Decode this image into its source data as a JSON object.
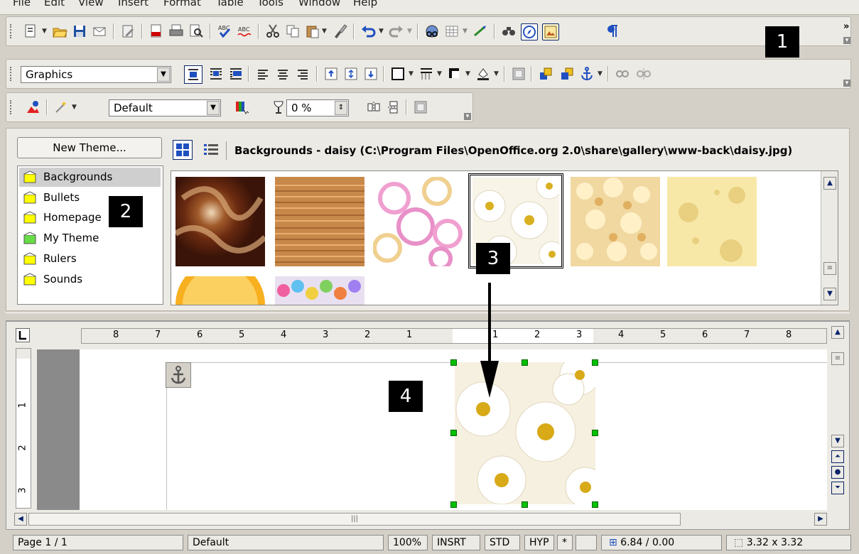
{
  "menu": [
    "File",
    "Edit",
    "View",
    "Insert",
    "Format",
    "Table",
    "Tools",
    "Window",
    "Help"
  ],
  "toolbar2": {
    "style_combo": "Graphics"
  },
  "toolbar3": {
    "mode_combo": "Default",
    "transparency": "0 %"
  },
  "callouts": [
    "1",
    "2",
    "3",
    "4"
  ],
  "gallery": {
    "new_theme_label": "New Theme...",
    "title": "Backgrounds - daisy (C:\\Program Files\\OpenOffice.org 2.0\\share\\gallery\\www-back\\daisy.jpg)",
    "themes": [
      {
        "label": "Backgrounds",
        "color": "#ffff00"
      },
      {
        "label": "Bullets",
        "color": "#ffff00"
      },
      {
        "label": "Homepage",
        "color": "#ffff00"
      },
      {
        "label": "My Theme",
        "color": "#66dd44"
      },
      {
        "label": "Rulers",
        "color": "#ffff00"
      },
      {
        "label": "Sounds",
        "color": "#ffff00"
      }
    ]
  },
  "ruler_numbers": [
    "8",
    "7",
    "6",
    "5",
    "4",
    "3",
    "2",
    "1",
    "1",
    "2",
    "3",
    "4",
    "5",
    "6",
    "7",
    "8"
  ],
  "vruler_numbers": [
    "1",
    "2",
    "3"
  ],
  "status": {
    "page": "Page 1 / 1",
    "style": "Default",
    "zoom": "100%",
    "insert_mode": "INSRT",
    "selection_mode": "STD",
    "hyperlink_mode": "HYP",
    "modified": "*",
    "position": "6.84 / 0.00",
    "size": "3.32 x 3.32"
  },
  "colors": {
    "accent": "#0a246a",
    "chrome": "#eceae4",
    "handle": "#00c000"
  }
}
